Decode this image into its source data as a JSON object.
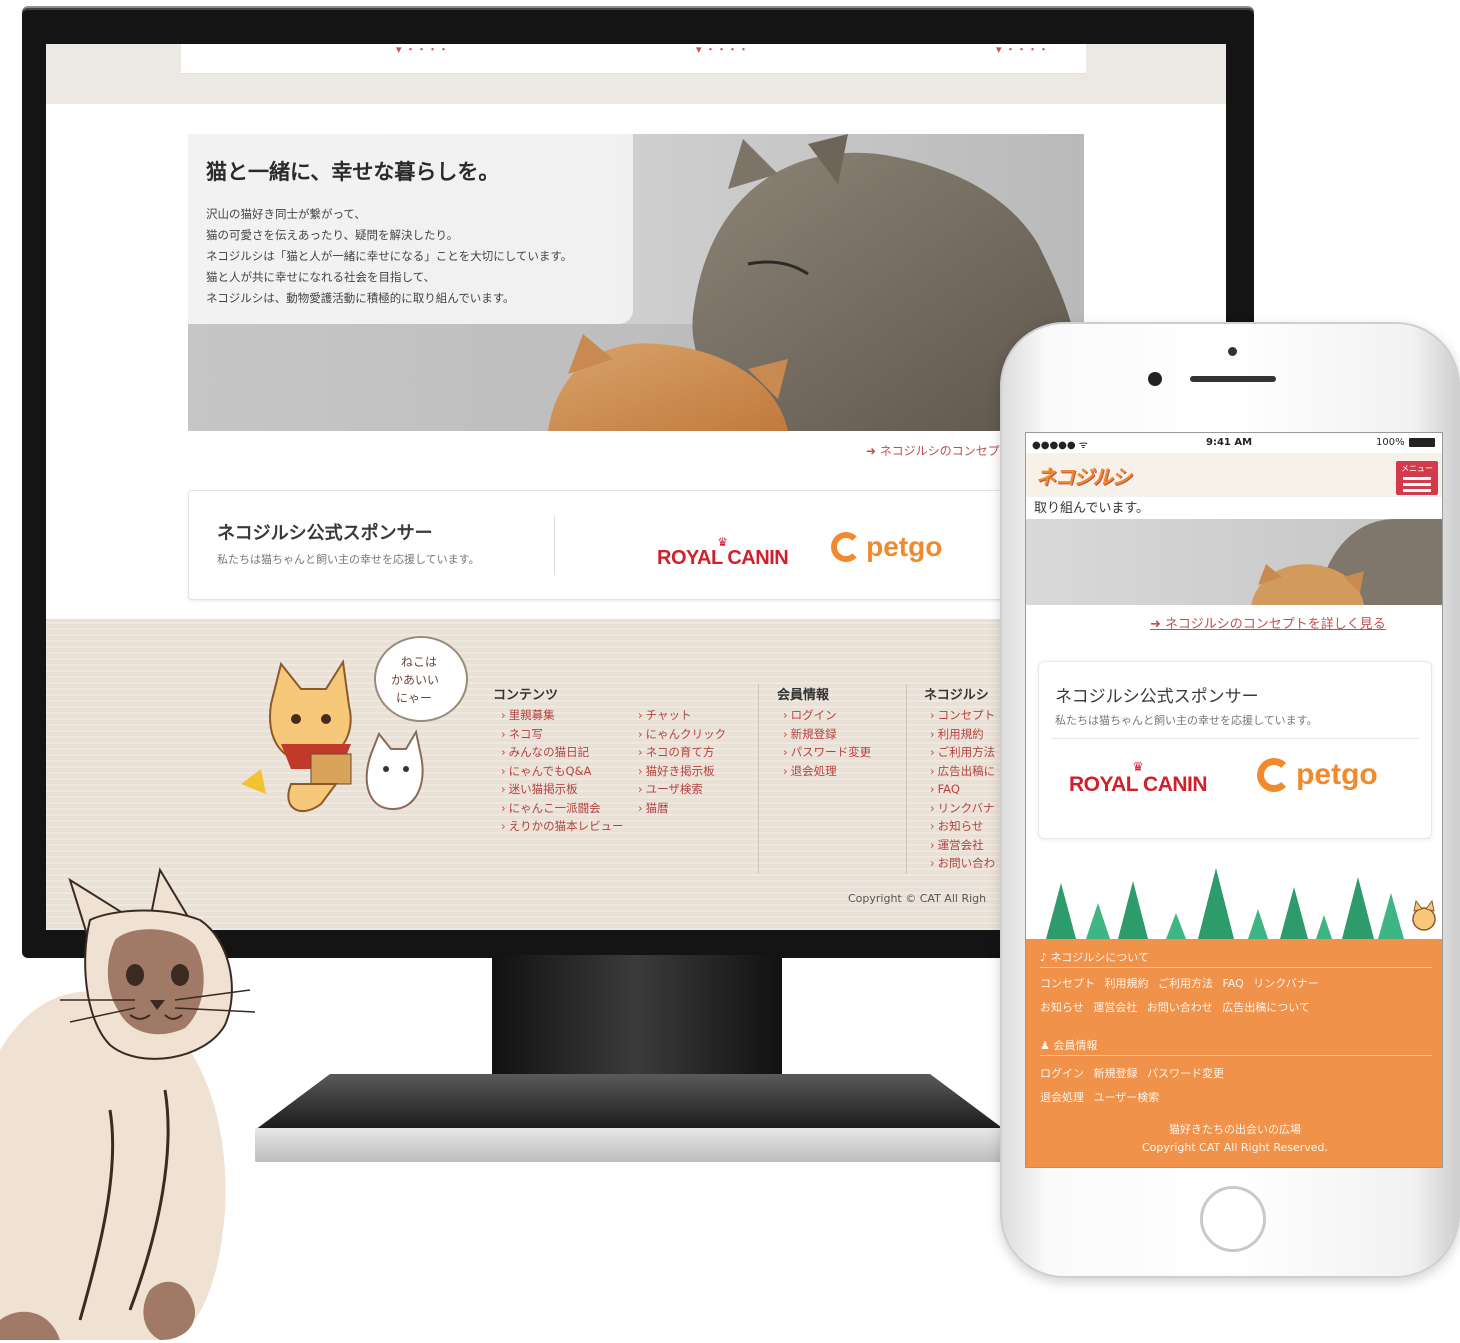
{
  "desktop": {
    "hero": {
      "title": "猫と一緒に、幸せな暮らしを。",
      "lines": [
        "沢山の猫好き同士が繋がって、",
        "猫の可愛さを伝えあったり、疑問を解決したり。",
        "ネコジルシは「猫と人が一緒に幸せになる」ことを大切にしています。",
        "猫と人が共に幸せになれる社会を目指して、",
        "ネコジルシは、動物愛護活動に積極的に取り組んでいます。"
      ]
    },
    "concept_link": "ネコジルシのコンセプ",
    "sponsor": {
      "title": "ネコジルシ公式スポンサー",
      "subtitle": "私たちは猫ちゃんと飼い主の幸せを応援しています。",
      "logos": [
        "ROYAL CANIN",
        "petgo"
      ]
    },
    "mascot_speech": [
      "ねこは",
      "かあいい",
      "にゃー"
    ],
    "footer": {
      "contents_heading": "コンテンツ",
      "contents_col1": [
        "里親募集",
        "ネコ写",
        "みんなの猫日記",
        "にゃんでもQ&A",
        "迷い猫掲示板",
        "にゃんこ一派闘会",
        "えりかの猫本レビュー"
      ],
      "contents_col2": [
        "チャット",
        "にゃんクリック",
        "ネコの育て方",
        "猫好き掲示板",
        "ユーザ検索",
        "猫暦"
      ],
      "member_heading": "会員情報",
      "member_links": [
        "ログイン",
        "新規登録",
        "パスワード変更",
        "退会処理"
      ],
      "neko_heading": "ネコジルシ",
      "neko_links": [
        "コンセプト",
        "利用規約",
        "ご利用方法",
        "広告出稿に",
        "FAQ",
        "リンクバナ",
        "お知らせ",
        "運営会社",
        "お問い合わ"
      ],
      "copyright": "Copyright © CAT All Righ"
    }
  },
  "phone": {
    "status": {
      "carrier": "●●●●● ᯤ",
      "time": "9:41 AM",
      "battery": "100%"
    },
    "logo": "ネコジルシ",
    "menu_label": "メニュー",
    "intro_line": "取り組んでいます。",
    "concept_link": "ネコジルシのコンセプトを詳しく見る",
    "sponsor": {
      "title": "ネコジルシ公式スポンサー",
      "subtitle": "私たちは猫ちゃんと飼い主の幸せを応援しています。",
      "logos": [
        "ROYAL CANIN",
        "petgo"
      ]
    },
    "footer": {
      "about_heading": "ネコジルシについて",
      "about_row1": "コンセプト 利用規約 ご利用方法 FAQ リンクバナー",
      "about_row2": "お知らせ 運営会社 お問い合わせ 広告出稿について",
      "member_heading": "会員情報",
      "member_row1": "ログイン 新規登録 パスワード変更",
      "member_row2": "退会処理 ユーザー検索",
      "tagline": "猫好きたちの出会いの広場",
      "copyright": "Copyright CAT All Right Reserved."
    }
  },
  "colors": {
    "accent_red": "#c0504d",
    "footer_orange": "#f0924a",
    "petgo_orange": "#f08a2c",
    "royal_red": "#d0202c"
  }
}
